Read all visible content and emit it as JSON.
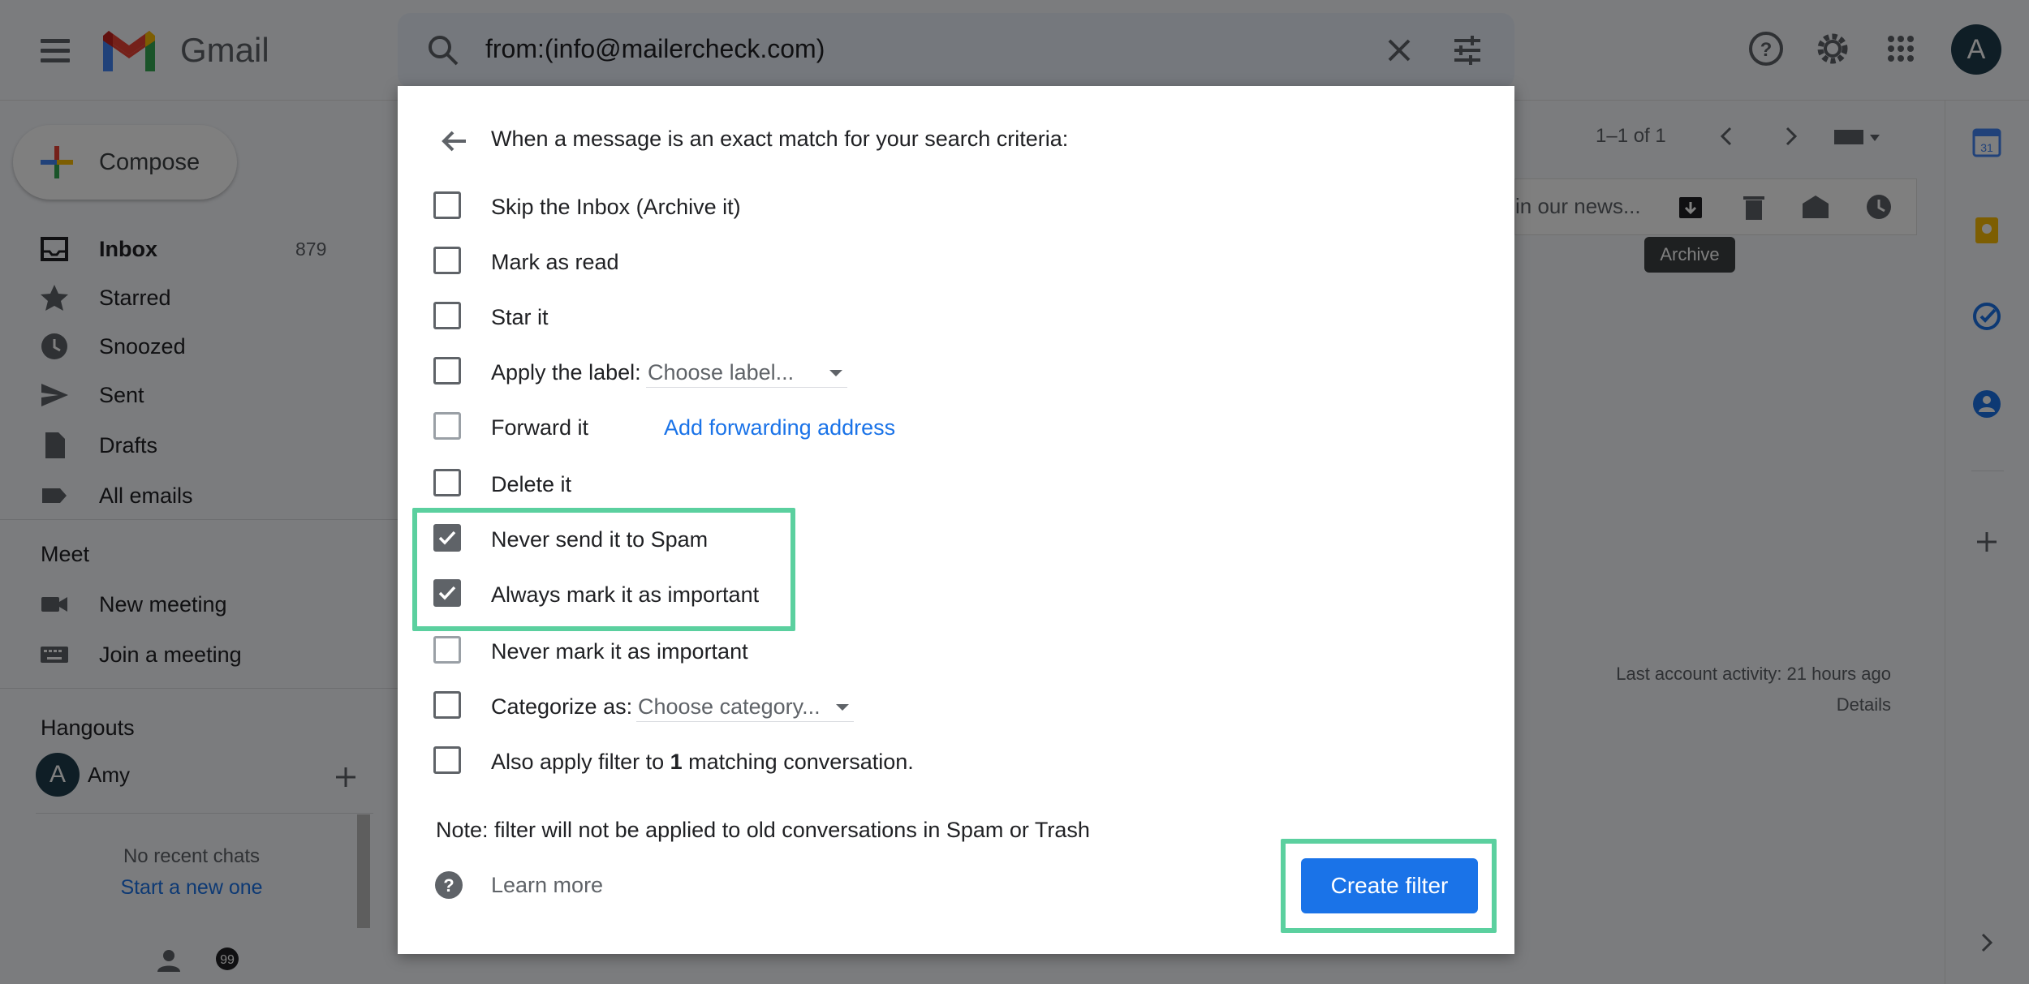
{
  "app": {
    "name": "Gmail",
    "account_initial": "A"
  },
  "search": {
    "value": "from:(info@mailercheck.com)"
  },
  "sidebar": {
    "compose_label": "Compose",
    "items": [
      {
        "label": "Inbox",
        "count": "879"
      },
      {
        "label": "Starred"
      },
      {
        "label": "Snoozed"
      },
      {
        "label": "Sent"
      },
      {
        "label": "Drafts"
      },
      {
        "label": "All emails"
      }
    ],
    "meet": {
      "title": "Meet",
      "new_meeting": "New meeting",
      "join_meeting": "Join a meeting"
    },
    "hangouts": {
      "title": "Hangouts",
      "user_initial": "A",
      "user_name": "Amy",
      "no_chats": "No recent chats",
      "start_new": "Start a new one"
    }
  },
  "mail_toolbar": {
    "paging": "1–1 of 1",
    "snippet": "in our news...",
    "tooltip": "Archive",
    "activity": "Last account activity: 21 hours ago",
    "details": "Details"
  },
  "filter_dialog": {
    "title": "When a message is an exact match for your search criteria:",
    "options": {
      "skip_inbox": {
        "label": "Skip the Inbox (Archive it)",
        "checked": false
      },
      "mark_read": {
        "label": "Mark as read",
        "checked": false
      },
      "star_it": {
        "label": "Star it",
        "checked": false
      },
      "apply_label": {
        "label": "Apply the label:",
        "select": "Choose label...",
        "checked": false
      },
      "forward_it": {
        "label": "Forward it",
        "link": "Add forwarding address",
        "checked": false
      },
      "delete_it": {
        "label": "Delete it",
        "checked": false
      },
      "never_spam": {
        "label": "Never send it to Spam",
        "checked": true
      },
      "always_important": {
        "label": "Always mark it as important",
        "checked": true
      },
      "never_important": {
        "label": "Never mark it as important",
        "checked": false
      },
      "categorize": {
        "label": "Categorize as:",
        "select": "Choose category...",
        "checked": false
      },
      "also_apply": {
        "prefix": "Also apply filter to ",
        "count": "1",
        "suffix": " matching conversation.",
        "checked": false
      }
    },
    "note": "Note: filter will not be applied to old conversations in Spam or Trash",
    "learn_more": "Learn more",
    "create_button": "Create filter"
  },
  "colors": {
    "accent_blue": "#1a73e8",
    "highlight_green": "#5bd09f",
    "checkbox_gray": "#5f6368"
  }
}
